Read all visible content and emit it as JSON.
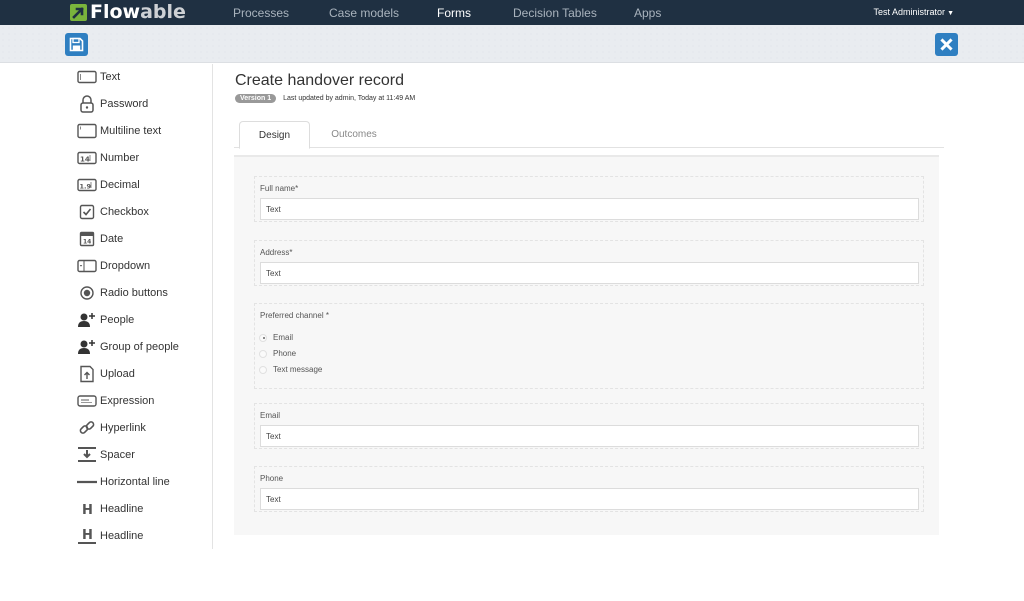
{
  "app": {
    "logo_text_a": "Flow",
    "logo_text_b": "able",
    "brand_color": "#7ab43c",
    "nav_bg": "#1f3042",
    "accent": "#2f7fc1"
  },
  "nav": {
    "items": [
      {
        "label": "Processes",
        "active": false
      },
      {
        "label": "Case models",
        "active": false
      },
      {
        "label": "Forms",
        "active": true
      },
      {
        "label": "Decision Tables",
        "active": false
      },
      {
        "label": "Apps",
        "active": false
      }
    ],
    "user": "Test Administrator"
  },
  "toolbar": {
    "save_icon": "floppy-disk-icon",
    "close_icon": "close-icon"
  },
  "palette": {
    "items": [
      {
        "label": "Text",
        "icon": "text-field-icon"
      },
      {
        "label": "Password",
        "icon": "lock-icon"
      },
      {
        "label": "Multiline text",
        "icon": "multiline-text-icon"
      },
      {
        "label": "Number",
        "icon": "number-icon"
      },
      {
        "label": "Decimal",
        "icon": "decimal-icon"
      },
      {
        "label": "Checkbox",
        "icon": "checkbox-icon"
      },
      {
        "label": "Date",
        "icon": "calendar-icon"
      },
      {
        "label": "Dropdown",
        "icon": "dropdown-icon"
      },
      {
        "label": "Radio buttons",
        "icon": "radio-icon"
      },
      {
        "label": "People",
        "icon": "person-add-icon"
      },
      {
        "label": "Group of people",
        "icon": "group-add-icon"
      },
      {
        "label": "Upload",
        "icon": "upload-icon"
      },
      {
        "label": "Expression",
        "icon": "expression-icon"
      },
      {
        "label": "Hyperlink",
        "icon": "link-icon"
      },
      {
        "label": "Spacer",
        "icon": "spacer-icon"
      },
      {
        "label": "Horizontal line",
        "icon": "horizontal-line-icon"
      },
      {
        "label": "Headline",
        "icon": "headline-icon"
      },
      {
        "label": "Headline",
        "icon": "headline-underlined-icon"
      }
    ]
  },
  "form": {
    "title": "Create handover record",
    "version": "Version 1",
    "last_updated": "Last updated by admin, Today at 11:49 AM",
    "tabs": [
      {
        "label": "Design",
        "active": true
      },
      {
        "label": "Outcomes",
        "active": false
      }
    ],
    "fields": [
      {
        "label": "Full name*",
        "type": "text",
        "value": "Text"
      },
      {
        "label": "Address*",
        "type": "text",
        "value": "Text"
      },
      {
        "label": "Preferred channel *",
        "type": "radio",
        "options": [
          {
            "label": "Email",
            "checked": true
          },
          {
            "label": "Phone",
            "checked": false
          },
          {
            "label": "Text message",
            "checked": false
          }
        ]
      },
      {
        "label": "Email",
        "type": "text",
        "value": "Text"
      },
      {
        "label": "Phone",
        "type": "text",
        "value": "Text"
      }
    ]
  }
}
